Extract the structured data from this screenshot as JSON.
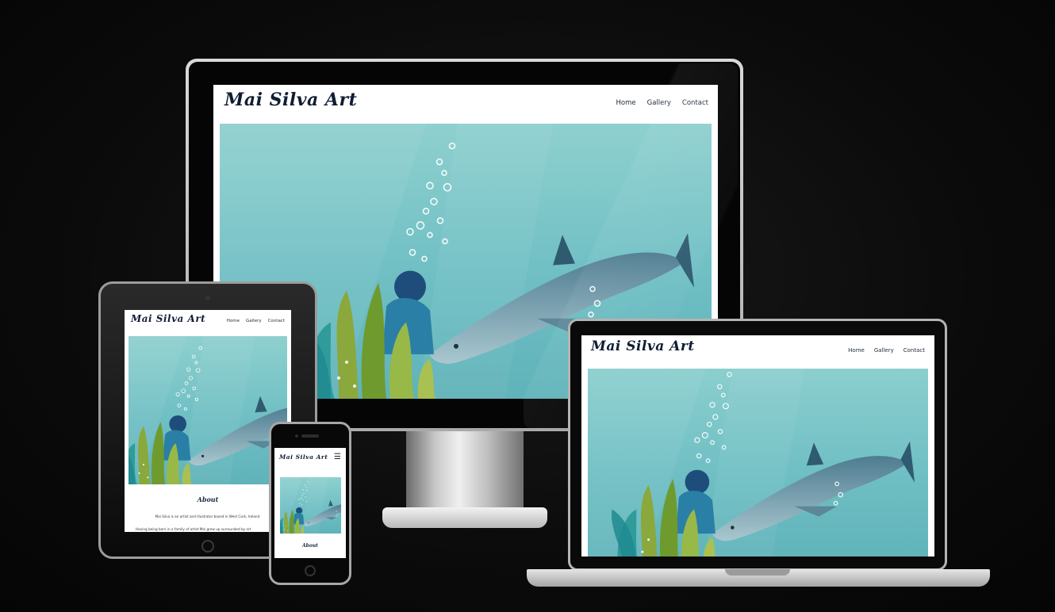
{
  "site": {
    "logo": "Mai Silva Art",
    "nav": [
      "Home",
      "Gallery",
      "Contact"
    ],
    "about_title": "About",
    "about_line1": "Mai Silva is an artist and illustrator based in West Cork, Ireland.",
    "about_line2": "Having being born in a family of artist Mai grew up surrounded by art"
  },
  "icons": {
    "menu": "☰"
  },
  "colors": {
    "background": "#0b0b0b",
    "sea": "#7cc4c8",
    "logo_text": "#0f1d33"
  }
}
